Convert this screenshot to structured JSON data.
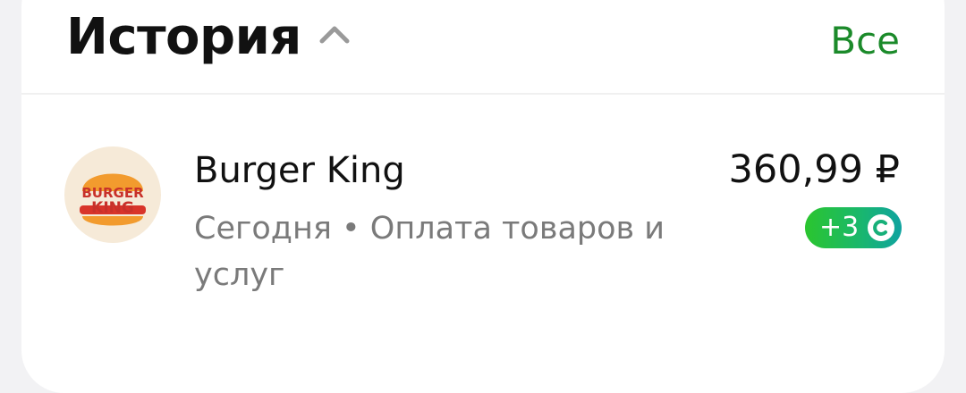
{
  "history": {
    "title": "История",
    "see_all_label": "Все"
  },
  "transaction": {
    "merchant": "Burger King",
    "logo_text_top": "BURGER",
    "logo_text_bottom": "KING",
    "details": "Сегодня • Оплата товаров и услуг",
    "amount": "360,99 ₽",
    "bonus": "+3"
  },
  "colors": {
    "accent_green": "#1b8a2a",
    "text_primary": "#111111",
    "text_secondary": "#7a7a7a",
    "bonus_gradient_start": "#2bc52e",
    "bonus_gradient_end": "#0fa3a0"
  },
  "icons": {
    "collapse": "chevron-up-icon",
    "bonus": "sber-coin-icon",
    "merchant_logo": "burger-king-logo"
  }
}
